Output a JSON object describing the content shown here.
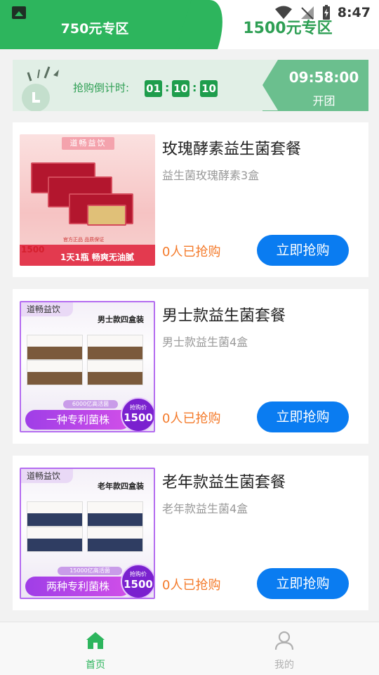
{
  "status_bar": {
    "time": "8:47"
  },
  "tabs": [
    {
      "label": "750元专区",
      "active": true
    },
    {
      "label": "1500元专区",
      "active": false
    }
  ],
  "countdown": {
    "label": "抢购倒计时:",
    "hours": "01",
    "minutes": "10",
    "seconds": "10",
    "open_time": "09:58:00",
    "open_label": "开团"
  },
  "products": [
    {
      "title": "玫瑰酵素益生菌套餐",
      "subtitle": "益生菌玫瑰酵素3盒",
      "sold": "0人已抢购",
      "button": "立即抢购",
      "image": {
        "brand": "道畅益饮",
        "price": "1500",
        "slogan": "1天1瓶 畅爽无油腻",
        "tags": "官方正品 品质保证"
      }
    },
    {
      "title": "男士款益生菌套餐",
      "subtitle": "男士款益生菌4盒",
      "sold": "0人已抢购",
      "button": "立即抢购",
      "image": {
        "brand": "道畅益饮",
        "pack": "男士款四盒装",
        "bacteria": "6000亿高活菌",
        "patent": "一种专利菌株",
        "price_label": "抢购价",
        "price": "1500"
      }
    },
    {
      "title": "老年款益生菌套餐",
      "subtitle": "老年款益生菌4盒",
      "sold": "0人已抢购",
      "button": "立即抢购",
      "image": {
        "brand": "道畅益饮",
        "pack": "老年款四盒装",
        "bacteria": "15000亿高活菌",
        "patent": "两种专利菌株",
        "price_label": "抢购价",
        "price": "1500"
      }
    }
  ],
  "nav": [
    {
      "label": "首页",
      "active": true
    },
    {
      "label": "我的",
      "active": false
    }
  ],
  "colors": {
    "green": "#2db55d",
    "blue": "#0a7cf1",
    "orange": "#f47a2a"
  }
}
